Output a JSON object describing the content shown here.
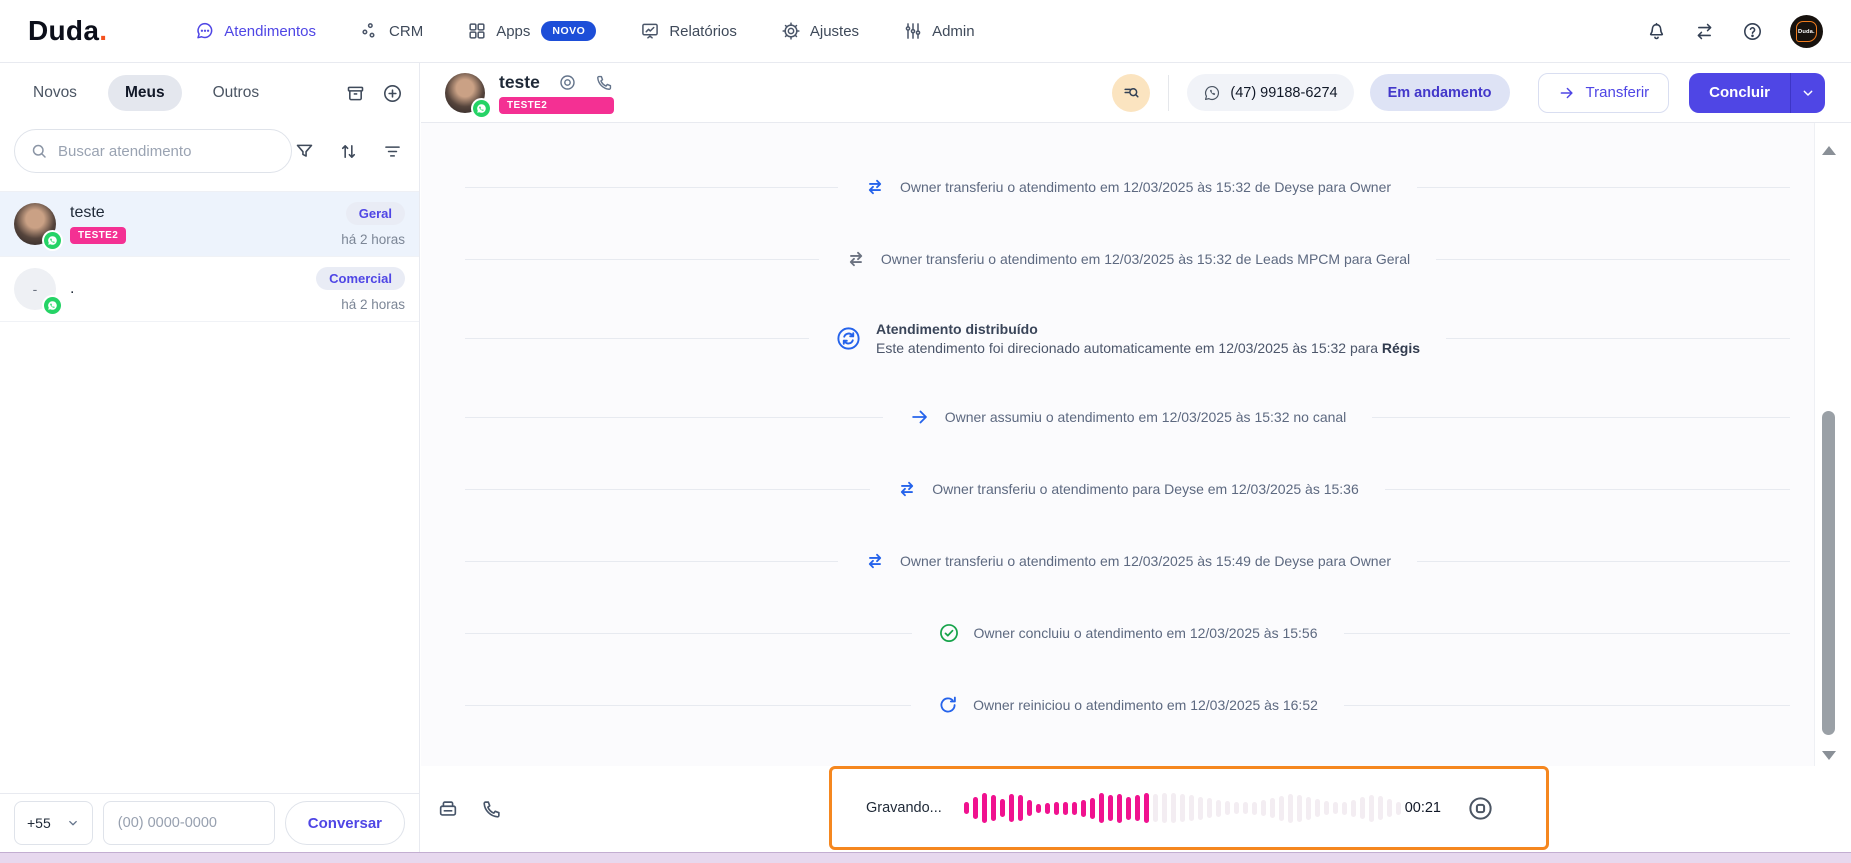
{
  "nav": {
    "logo": {
      "text": "Duda",
      "dot": "."
    },
    "items": [
      {
        "slug": "atendimentos",
        "label": "Atendimentos",
        "icon": "chat",
        "active": true
      },
      {
        "slug": "crm",
        "label": "CRM",
        "icon": "crm",
        "active": false
      },
      {
        "slug": "apps",
        "label": "Apps",
        "icon": "apps",
        "badge": "NOVO",
        "active": false
      },
      {
        "slug": "relatorios",
        "label": "Relatórios",
        "icon": "reports",
        "active": false
      },
      {
        "slug": "ajustes",
        "label": "Ajustes",
        "icon": "gear",
        "active": false
      },
      {
        "slug": "admin",
        "label": "Admin",
        "icon": "sliders",
        "active": false
      }
    ],
    "right_icons": [
      "bell-icon",
      "swap-horizontal-icon",
      "help-icon"
    ],
    "avatar_label": "Duda."
  },
  "sidebar": {
    "tabs": [
      {
        "slug": "novos",
        "label": "Novos",
        "active": false
      },
      {
        "slug": "meus",
        "label": "Meus",
        "active": true
      },
      {
        "slug": "outros",
        "label": "Outros",
        "active": false
      }
    ],
    "actions": [
      "archive-icon",
      "add-icon"
    ],
    "search": {
      "placeholder": "Buscar atendimento",
      "icons": [
        "filter-funnel-icon",
        "sort-icon",
        "filter-lines-icon"
      ]
    },
    "conversations": [
      {
        "name": "teste",
        "tag": "TESTE2",
        "department": "Geral",
        "time": "há 2 horas",
        "channel": "whatsapp",
        "avatar": "photo",
        "selected": true
      },
      {
        "name": ".",
        "avatar_text": "-",
        "department": "Comercial",
        "time": "há 2 horas",
        "channel": "whatsapp",
        "avatar": "placeholder",
        "selected": false
      }
    ],
    "dialer": {
      "country_code": "+55",
      "phone_placeholder": "(00) 0000-0000",
      "call_button": "Conversar"
    }
  },
  "chat": {
    "header": {
      "name": "teste",
      "tag": "TESTE2",
      "phone": "(47) 99188-6274",
      "status": "Em andamento",
      "transfer_button": "Transferir",
      "conclude_button": "Concluir",
      "channel": "whatsapp",
      "icons": [
        "view-icon",
        "phone-icon",
        "search-list-icon"
      ]
    },
    "events": [
      {
        "icon": "swap",
        "color": "blue",
        "text": "Owner transferiu o atendimento em 12/03/2025 às 15:32 de Deyse para Owner"
      },
      {
        "icon": "swap",
        "color": "gray",
        "text": "Owner transferiu o atendimento em 12/03/2025 às 15:32 de Leads MPCM para Geral"
      },
      {
        "icon": "sync-circle",
        "color": "blue",
        "title": "Atendimento distribuído",
        "text": "Este atendimento foi direcionado automaticamente em 12/03/2025 às 15:32 para ",
        "bold": "Régis"
      },
      {
        "icon": "arrow-right",
        "color": "blue",
        "text": "Owner assumiu o atendimento em 12/03/2025 às 15:32 no canal"
      },
      {
        "icon": "swap",
        "color": "blue",
        "text": "Owner transferiu o atendimento para Deyse em 12/03/2025 às 15:36"
      },
      {
        "icon": "swap",
        "color": "blue",
        "text": "Owner transferiu o atendimento em 12/03/2025 às 15:49 de Deyse para Owner"
      },
      {
        "icon": "check-circle",
        "color": "green",
        "text": "Owner concluiu o atendimento em 12/03/2025 às 15:56"
      },
      {
        "icon": "refresh",
        "color": "blue",
        "text": "Owner reiniciou o atendimento em 12/03/2025 às 16:52"
      }
    ],
    "footer_icons": [
      "printer-icon",
      "phone-icon"
    ],
    "recorder": {
      "label": "Gravando...",
      "timer": "00:21",
      "stop_icon": "stop-icon",
      "wave_active": [
        12,
        22,
        30,
        26,
        18,
        28,
        26,
        16,
        9,
        11,
        13,
        13,
        13,
        17,
        21,
        30,
        26,
        29,
        23,
        26,
        30
      ],
      "wave_inactive": [
        28,
        30,
        30,
        28,
        26,
        23,
        20,
        17,
        14,
        12,
        12,
        13,
        16,
        20,
        25,
        29,
        27,
        23,
        18,
        14,
        12,
        13,
        17,
        22,
        27,
        24,
        18,
        13
      ]
    }
  },
  "colors": {
    "accent": "#4f46e5",
    "novo_badge": "#1d4ed8",
    "tag_pink": "#f43093",
    "waveform_pink": "#f0128f",
    "recorder_border": "#f5871f",
    "whatsapp_green": "#25d366",
    "event_blue": "#2563eb",
    "event_gray": "#6b7280",
    "event_green": "#16a34a",
    "status_bg": "#dee3f5",
    "logo_dot": "#f4511e"
  }
}
